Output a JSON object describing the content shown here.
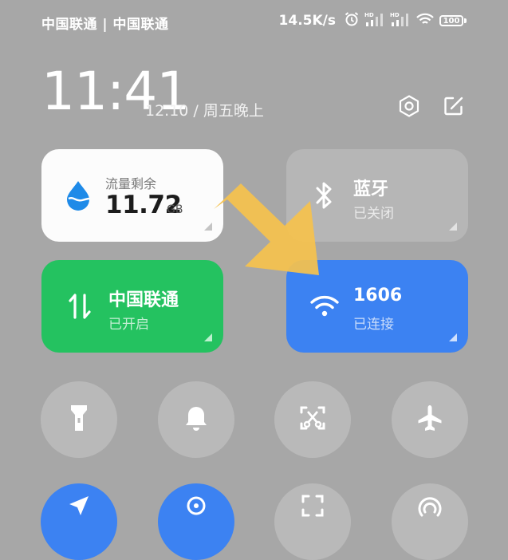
{
  "status_bar": {
    "carriers": "中国联通 | 中国联通",
    "speed": "14.5K/s",
    "signal1_badge": "HD",
    "signal2_badge": "HD",
    "battery": "100"
  },
  "header": {
    "time": "11:41",
    "date": "12.10 / 周五晚上"
  },
  "tiles": {
    "data": {
      "label": "流量剩余",
      "value": "11.72",
      "unit": "GB"
    },
    "bluetooth": {
      "title": "蓝牙",
      "status": "已关闭"
    },
    "cellular": {
      "title": "中国联通",
      "status": "已开启"
    },
    "wifi": {
      "title": "1606",
      "status": "已连接"
    }
  },
  "colors": {
    "background": "#a7a7a7",
    "cellular_active": "#24c260",
    "wifi_active": "#3c82f2",
    "arrow": "#f5c24e"
  },
  "icons": [
    "alarm-icon",
    "signal-icon",
    "wifi-icon",
    "settings-icon",
    "edit-icon",
    "water-drop-icon",
    "bluetooth-icon",
    "data-transfer-icon",
    "flashlight-icon",
    "bell-icon",
    "screenshot-icon",
    "airplane-icon",
    "location-icon",
    "circle-icon",
    "scan-icon",
    "hotspot-icon"
  ]
}
